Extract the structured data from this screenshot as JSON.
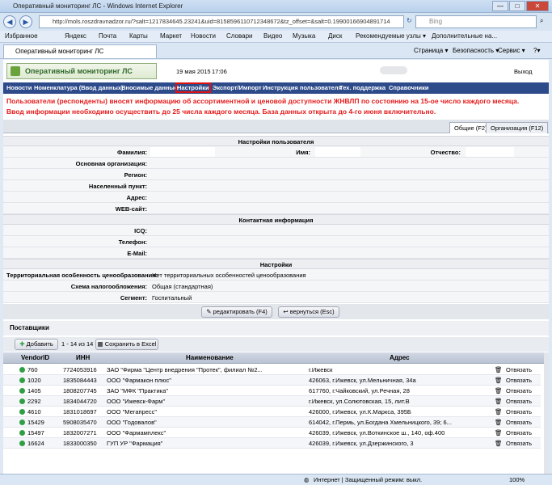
{
  "window": {
    "title": "Оперативный мониторинг ЛС - Windows Internet Explorer",
    "min": "—",
    "max": "□",
    "close": "✕"
  },
  "browser": {
    "url": "http://mols.roszdravnadzor.ru/?salt=1217834645.23241&uid=8158596110712348672&tz_offset=&salt=0.19900166904891714",
    "search_placeholder": "Bing"
  },
  "favorites": [
    {
      "label": "Избранное"
    },
    {
      "label": "Яндекс"
    },
    {
      "label": "Почта"
    },
    {
      "label": "Карты"
    },
    {
      "label": "Маркет"
    },
    {
      "label": "Новости"
    },
    {
      "label": "Словари"
    },
    {
      "label": "Видео"
    },
    {
      "label": "Музыка"
    },
    {
      "label": "Диск"
    },
    {
      "label": "Рекомендуемые узлы ▾"
    },
    {
      "label": "Дополнительные на..."
    }
  ],
  "tab": {
    "label": "Оперативный мониторинг ЛС"
  },
  "ie_tools": {
    "page": "Страница ▾",
    "security": "Безопасность ▾",
    "service": "Сервис ▾",
    "help": "?▾"
  },
  "app": {
    "logo": "Оперативный мониторинг ЛС",
    "date": "19 мая 2015",
    "time": "17:06",
    "exit": "Выход"
  },
  "menu": [
    "Новости",
    "Номенклатура (Ввод данных)",
    "Вносимые данные",
    "Настройки",
    "Экспорт/Импорт",
    "Инструкция пользователя",
    "Тех. поддержка",
    "Справочники"
  ],
  "notice": {
    "line1": "Пользователи (респонденты) вносят информацию об ассортиментной и ценовой доступности ЖНВЛП по состоянию на 15-ое число каждого месяца.",
    "line2": "Ввод информации необходимо осуществить до 25 числа каждого месяца. База данных открыта до 4-го июня включительно."
  },
  "form_tabs": {
    "general": "Общие (F2)",
    "org": "Организация (F12)"
  },
  "sections": {
    "user": "Настройки пользователя",
    "contact": "Контактная информация",
    "settings": "Настройки"
  },
  "fields": {
    "lastname": "Фамилия:",
    "firstname": "Имя:",
    "patronymic": "Отчество:",
    "main_org": "Основная организация:",
    "region": "Регион:",
    "locality": "Населенный пункт:",
    "address": "Адрес:",
    "website": "WEB-сайт:",
    "icq": "ICQ:",
    "phone": "Телефон:",
    "email": "E-Mail:",
    "territorial": "Территориальная особенность ценообразования:",
    "tax": "Схема налогообложения:",
    "segment": "Сегмент:"
  },
  "values": {
    "territorial": "Нет территориальных особенностей ценообразования",
    "tax": "Общая (стандартная)",
    "segment": "Госпитальный"
  },
  "buttons": {
    "edit": "редактировать (F4)",
    "back": "вернуться (Esc)",
    "add": "Добавить",
    "range": "1 - 14 из 14",
    "excel": "Сохранить в Excel"
  },
  "suppliers": {
    "title": "Поставщики",
    "columns": [
      "VendorID",
      "ИНН",
      "Наименование",
      "Адрес"
    ],
    "unlink": "Отвязать",
    "rows": [
      {
        "id": "760",
        "inn": "7724053916",
        "name": "ЗАО \"Фирма \"Центр внедрения \"Протек\", филиал №2...",
        "addr": "г.Ижевск"
      },
      {
        "id": "1020",
        "inn": "1835084443",
        "name": "ООО \"Фармакон плюс\"",
        "addr": "426063, г.Ижевск, ул.Мельничная, 34а"
      },
      {
        "id": "1405",
        "inn": "1808207745",
        "name": "ЗАО \"МФК \"Практика\"",
        "addr": "617760, г.Чайковский, ул.Речная, 28"
      },
      {
        "id": "2292",
        "inn": "1834044720",
        "name": "ООО \"Ижевск-Фарм\"",
        "addr": "г.Ижевск, ул.Солютовская, 15, лит.В"
      },
      {
        "id": "4610",
        "inn": "1831018697",
        "name": "ООО \"Мегапресс\"",
        "addr": "426000, г.Ижевск, ул.К.Маркса, 395Б"
      },
      {
        "id": "15429",
        "inn": "5908035470",
        "name": "ООО \"Годовалов\"",
        "addr": "614042, г.Пермь, ул.Богдана Хмельницкого, 39; 6..."
      },
      {
        "id": "15497",
        "inn": "1832007271",
        "name": "ООО \"Фармамплекс\"",
        "addr": "426039, г.Ижевск, ул.Воткинское ш., 140, оф.400"
      },
      {
        "id": "16624",
        "inn": "1833000350",
        "name": "ГУП УР \"Фармация\"",
        "addr": "426039, г.Ижевск, ул.Дзержинского, 3"
      }
    ]
  },
  "status": {
    "zone": "Интернет | Защищенный режим: выкл.",
    "zoom": "100%"
  },
  "colors": {
    "menu": "#2d4a8a",
    "notice": "#e51a1a",
    "highlight": "#e01010"
  }
}
